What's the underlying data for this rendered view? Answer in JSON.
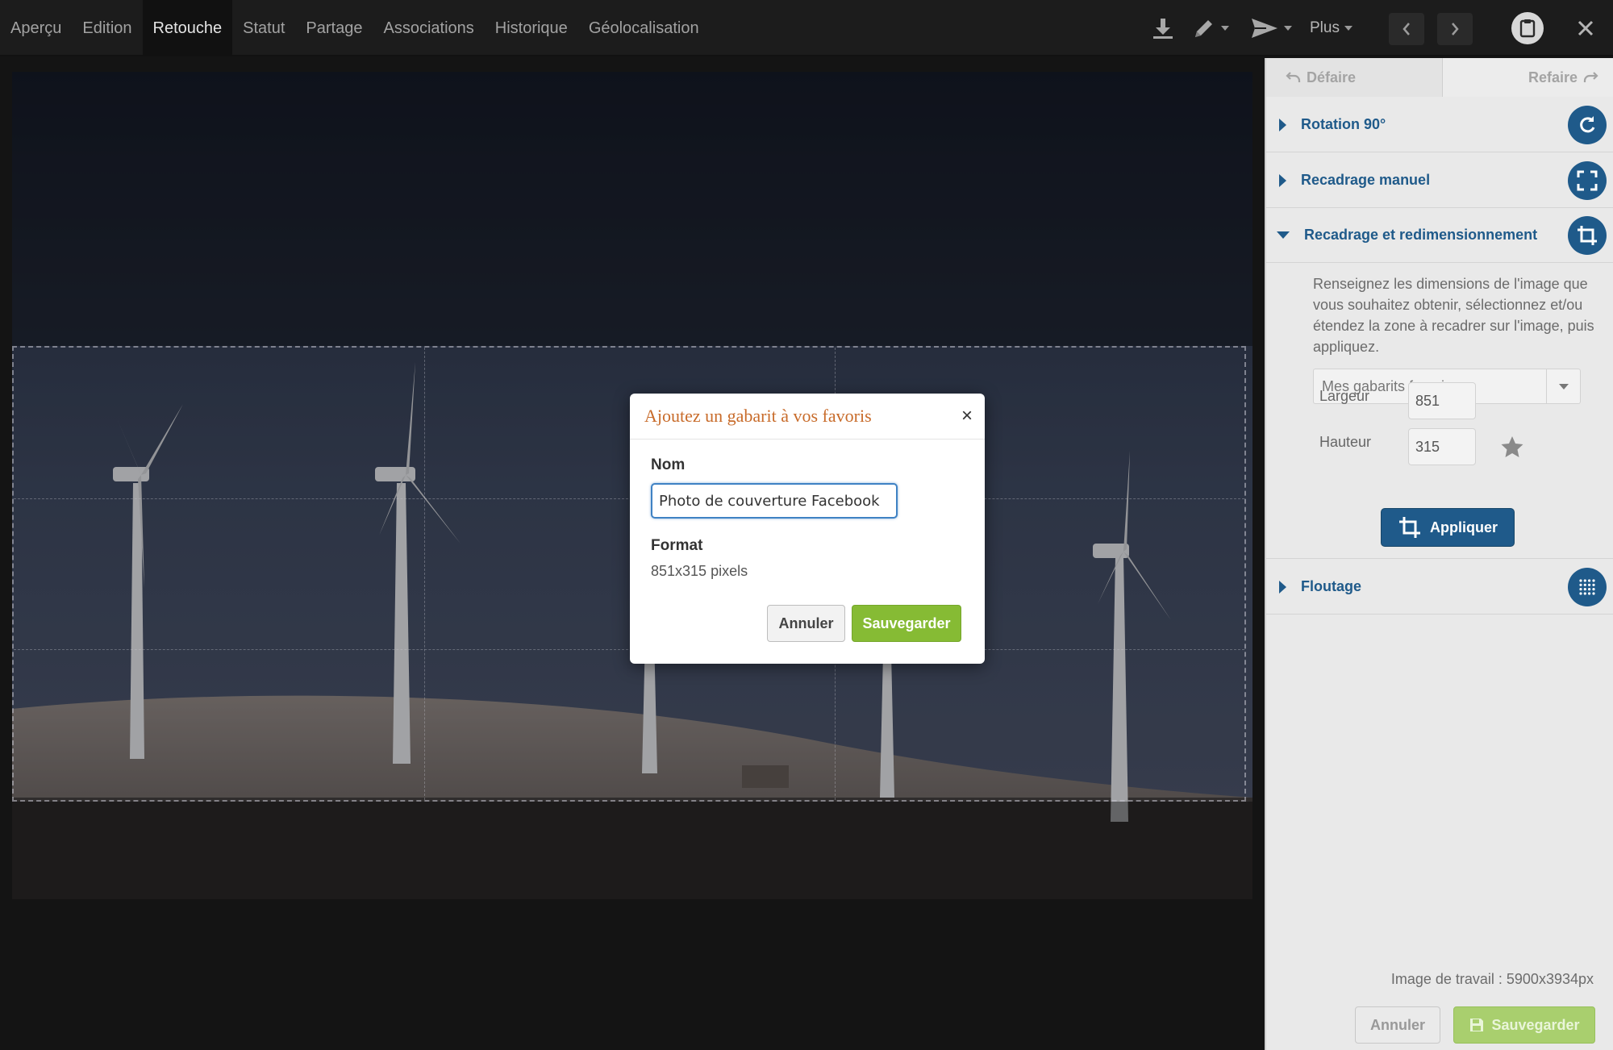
{
  "topbar": {
    "tabs": [
      {
        "label": "Aperçu"
      },
      {
        "label": "Edition"
      },
      {
        "label": "Retouche",
        "active": true
      },
      {
        "label": "Statut"
      },
      {
        "label": "Partage"
      },
      {
        "label": "Associations"
      },
      {
        "label": "Historique"
      },
      {
        "label": "Géolocalisation"
      }
    ],
    "plus_label": "Plus",
    "icons": [
      "download-icon",
      "pencil-icon",
      "send-icon",
      "chevron-left-icon",
      "chevron-right-icon",
      "clipboard-icon",
      "close-icon"
    ]
  },
  "panel": {
    "undo_label": "Défaire",
    "redo_label": "Refaire",
    "sections": {
      "rotation": {
        "label": "Rotation 90°",
        "icon": "rotate-icon"
      },
      "manual_crop": {
        "label": "Recadrage manuel",
        "icon": "expand-icon"
      },
      "crop_resize": {
        "label": "Recadrage et redimensionnement",
        "icon": "crop-icon",
        "expanded": true
      },
      "blur": {
        "label": "Floutage",
        "icon": "grid-dots-icon"
      }
    },
    "crop_resize": {
      "description": "Renseignez les dimensions de l'image que vous souhaitez obtenir, sélectionnez et/ou étendez la zone à recadrer sur l'image, puis appliquez.",
      "favorites_placeholder": "Mes gabarits favoris",
      "width_label": "Largeur",
      "width_value": "851",
      "height_label": "Hauteur",
      "height_value": "315",
      "apply_label": "Appliquer"
    },
    "work_image": "Image de travail : 5900x3934px",
    "cancel_label": "Annuler",
    "save_label": "Sauvegarder"
  },
  "modal": {
    "title": "Ajoutez un gabarit à vos favoris",
    "close_symbol": "×",
    "name_label": "Nom",
    "name_value": "Photo de couverture Facebook",
    "format_label": "Format",
    "format_value": "851x315 pixels",
    "cancel_label": "Annuler",
    "save_label": "Sauvegarder"
  },
  "colors": {
    "accent_blue": "#1f5a8a",
    "save_green": "#86bb34",
    "modal_title": "#c86b2a"
  }
}
